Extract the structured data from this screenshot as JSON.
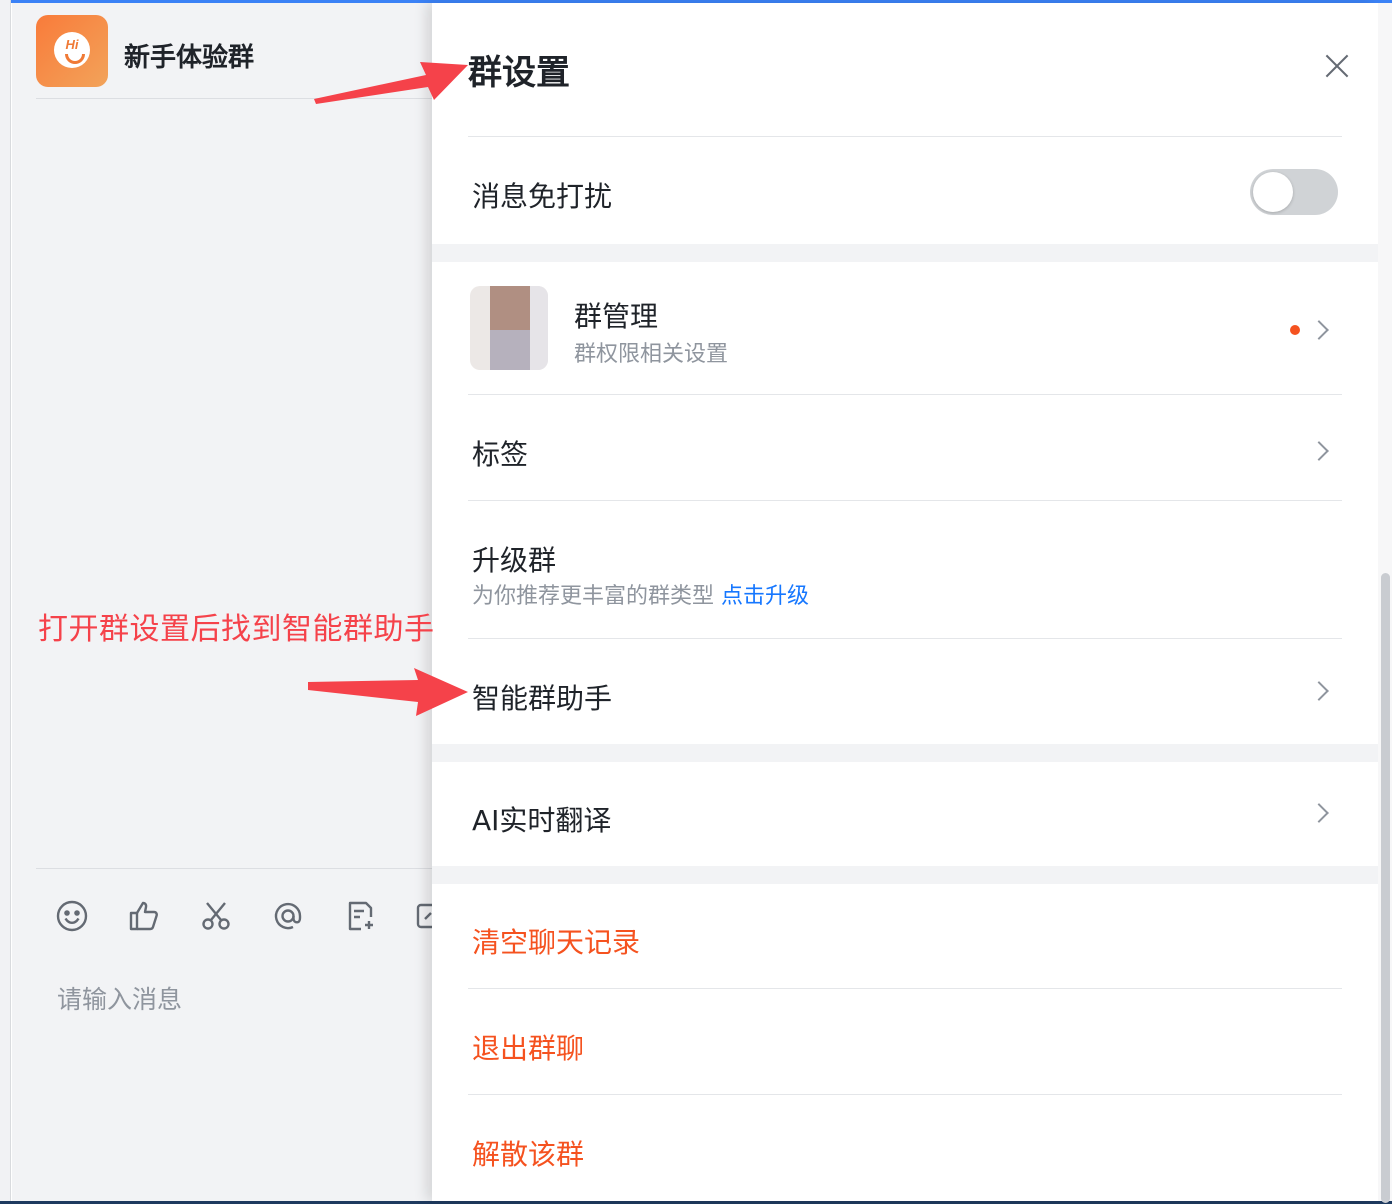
{
  "chat": {
    "group_name": "新手体验群",
    "avatar_text": "Hi",
    "input_placeholder": "请输入消息",
    "toolbar_icons": [
      "emoji-icon",
      "thumbs-up-icon",
      "scissors-icon",
      "at-icon",
      "document-add-icon",
      "screen-share-icon"
    ]
  },
  "annotation": {
    "text": "打开群设置后找到智能群助手"
  },
  "settings": {
    "title": "群设置",
    "do_not_disturb": {
      "label": "消息免打扰",
      "enabled": false
    },
    "group_management": {
      "label": "群管理",
      "subtitle": "群权限相关设置",
      "has_notification_dot": true
    },
    "tags": {
      "label": "标签"
    },
    "upgrade": {
      "label": "升级群",
      "subtitle": "为你推荐更丰富的群类型",
      "link": "点击升级"
    },
    "smart_assistant": {
      "label": "智能群助手"
    },
    "ai_translate": {
      "label": "AI实时翻译"
    },
    "clear_history": {
      "label": "清空聊天记录"
    },
    "leave_group": {
      "label": "退出群聊"
    },
    "dissolve_group": {
      "label": "解散该群"
    }
  },
  "colors": {
    "danger": "#f5521f",
    "link": "#1677ff",
    "annotation": "#f5424a",
    "avatar_gradient_start": "#f97b3a",
    "avatar_gradient_end": "#f2a35a"
  }
}
